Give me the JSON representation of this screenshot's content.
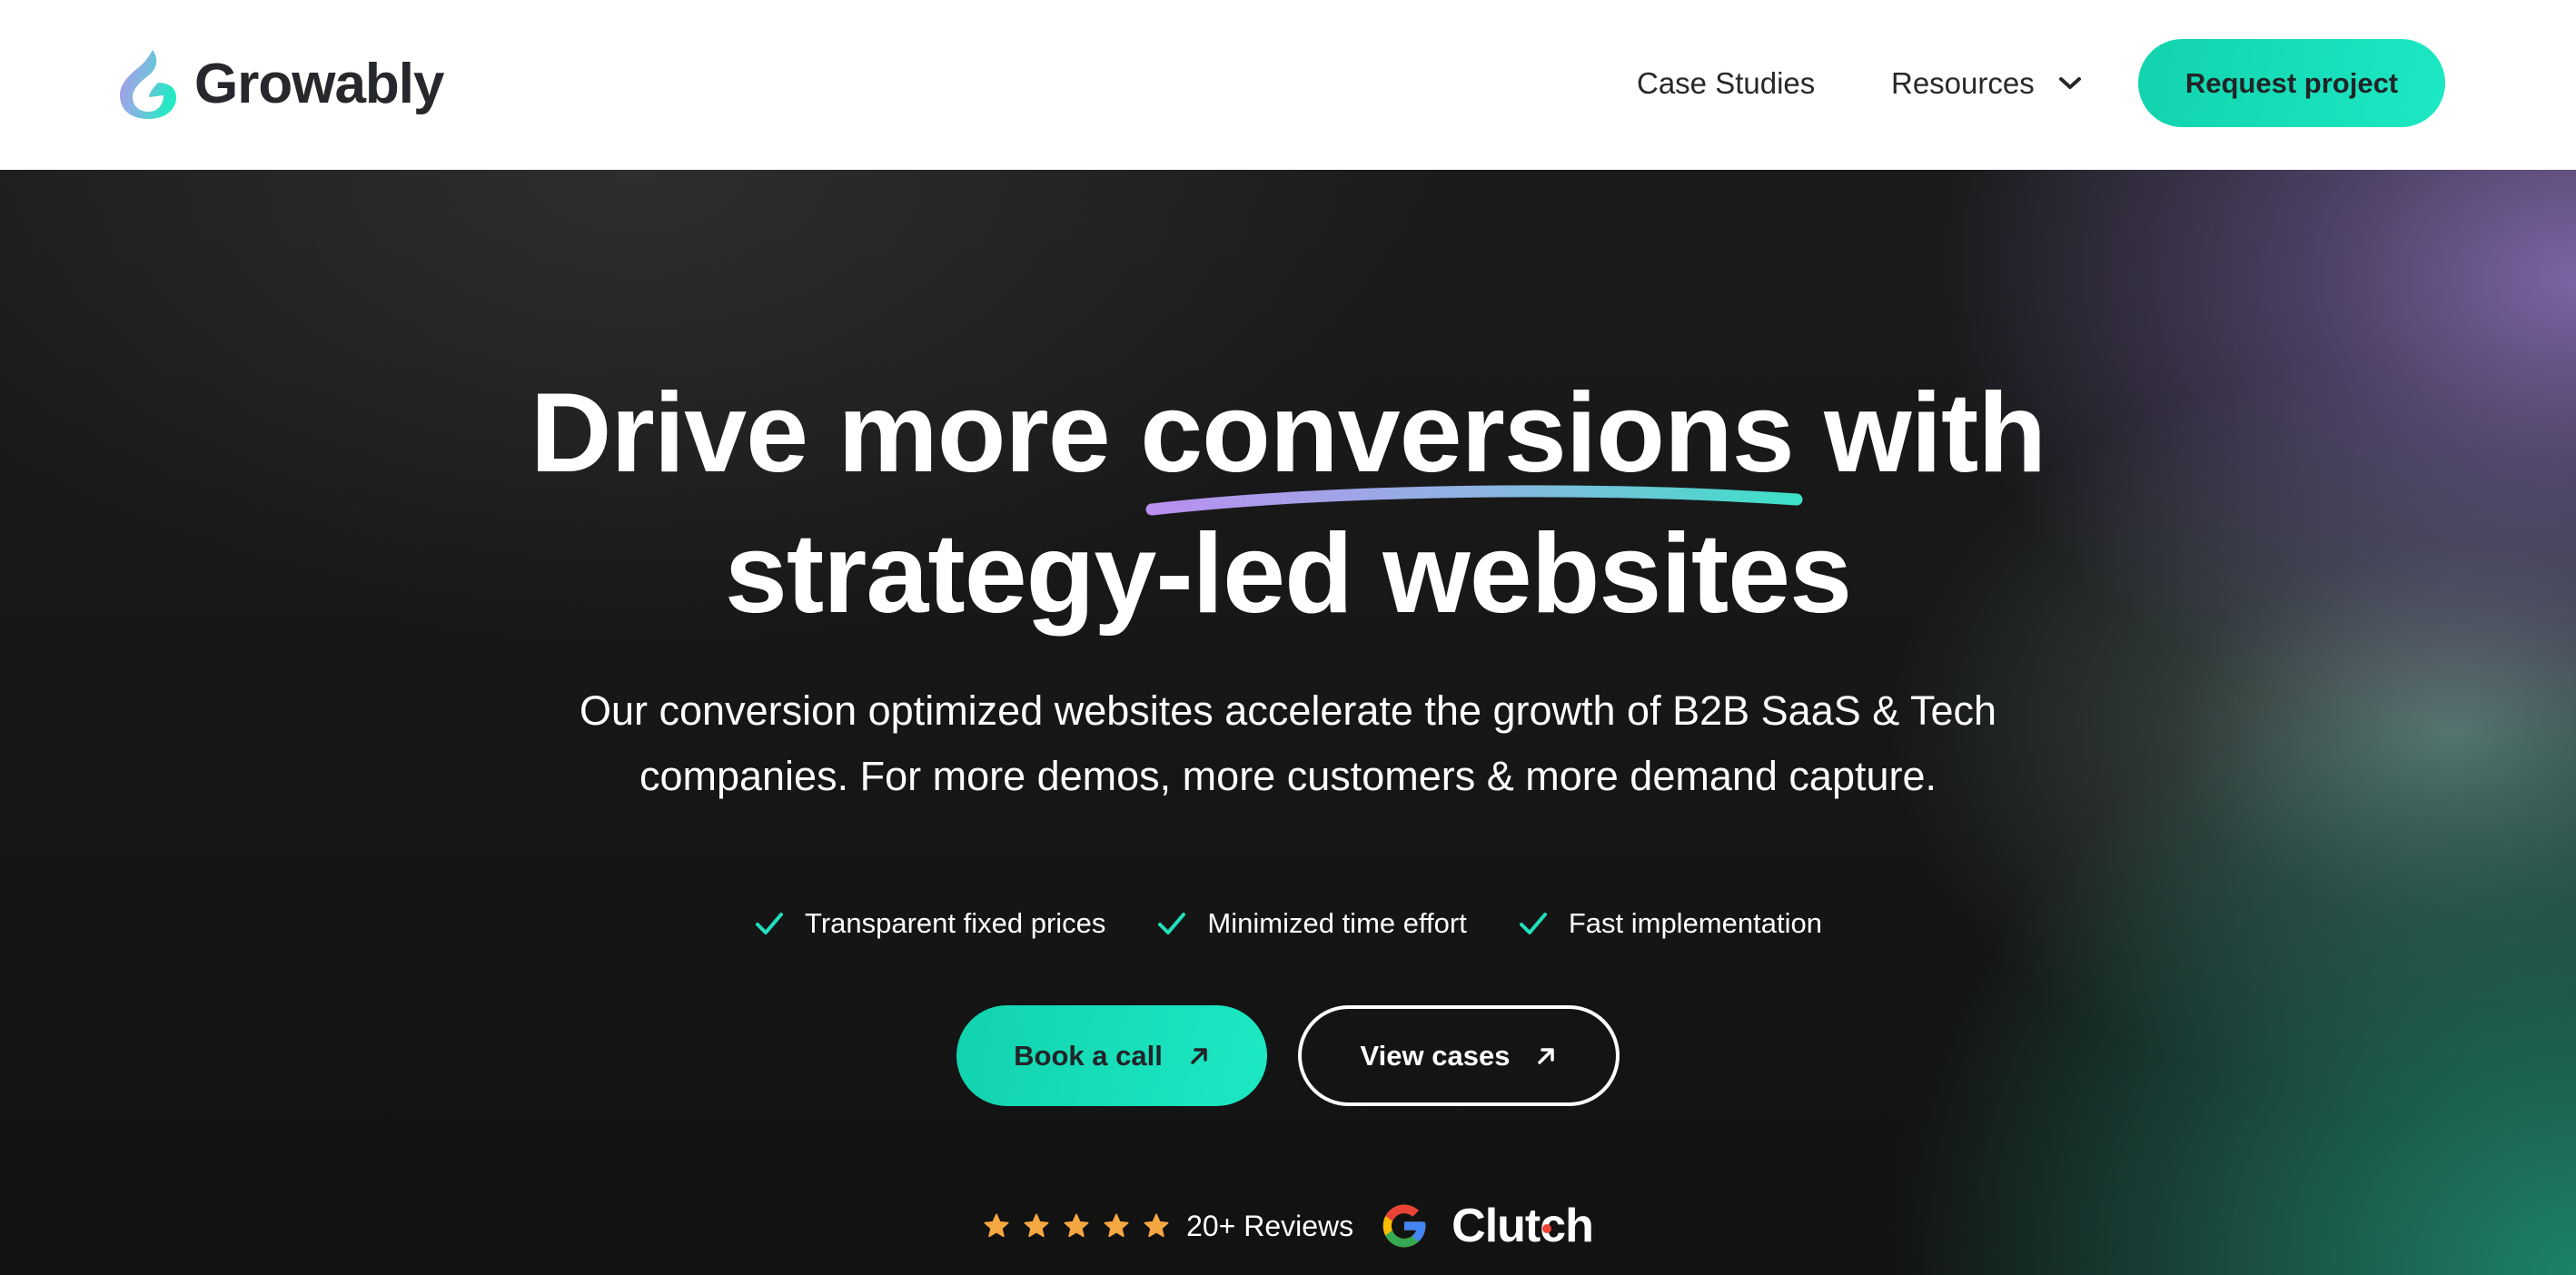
{
  "header": {
    "brand": "Growably",
    "nav": [
      {
        "label": "Case Studies",
        "has_dropdown": false
      },
      {
        "label": "Resources",
        "has_dropdown": true
      }
    ],
    "cta_label": "Request project"
  },
  "hero": {
    "headline_line1": "Drive more conversions with",
    "headline_line2": "strategy-led websites",
    "highlighted_word": "conversions",
    "subtext_line1": "Our conversion optimized websites accelerate the growth of B2B SaaS & Tech",
    "subtext_line2": "companies. For more demos, more customers & more demand capture.",
    "benefits": [
      "Transparent fixed prices",
      "Minimized time effort",
      "Fast implementation"
    ],
    "primary_cta": "Book a call",
    "secondary_cta": "View cases",
    "rating_stars": 5,
    "reviews_label": "20+ Reviews",
    "review_platforms": [
      "Google",
      "Clutch"
    ]
  },
  "colors": {
    "accent": "#16dfb9",
    "text_dark": "#26282b",
    "star": "#f5a742",
    "swoosh_start": "#b98ff0",
    "swoosh_end": "#3ee0c8"
  }
}
